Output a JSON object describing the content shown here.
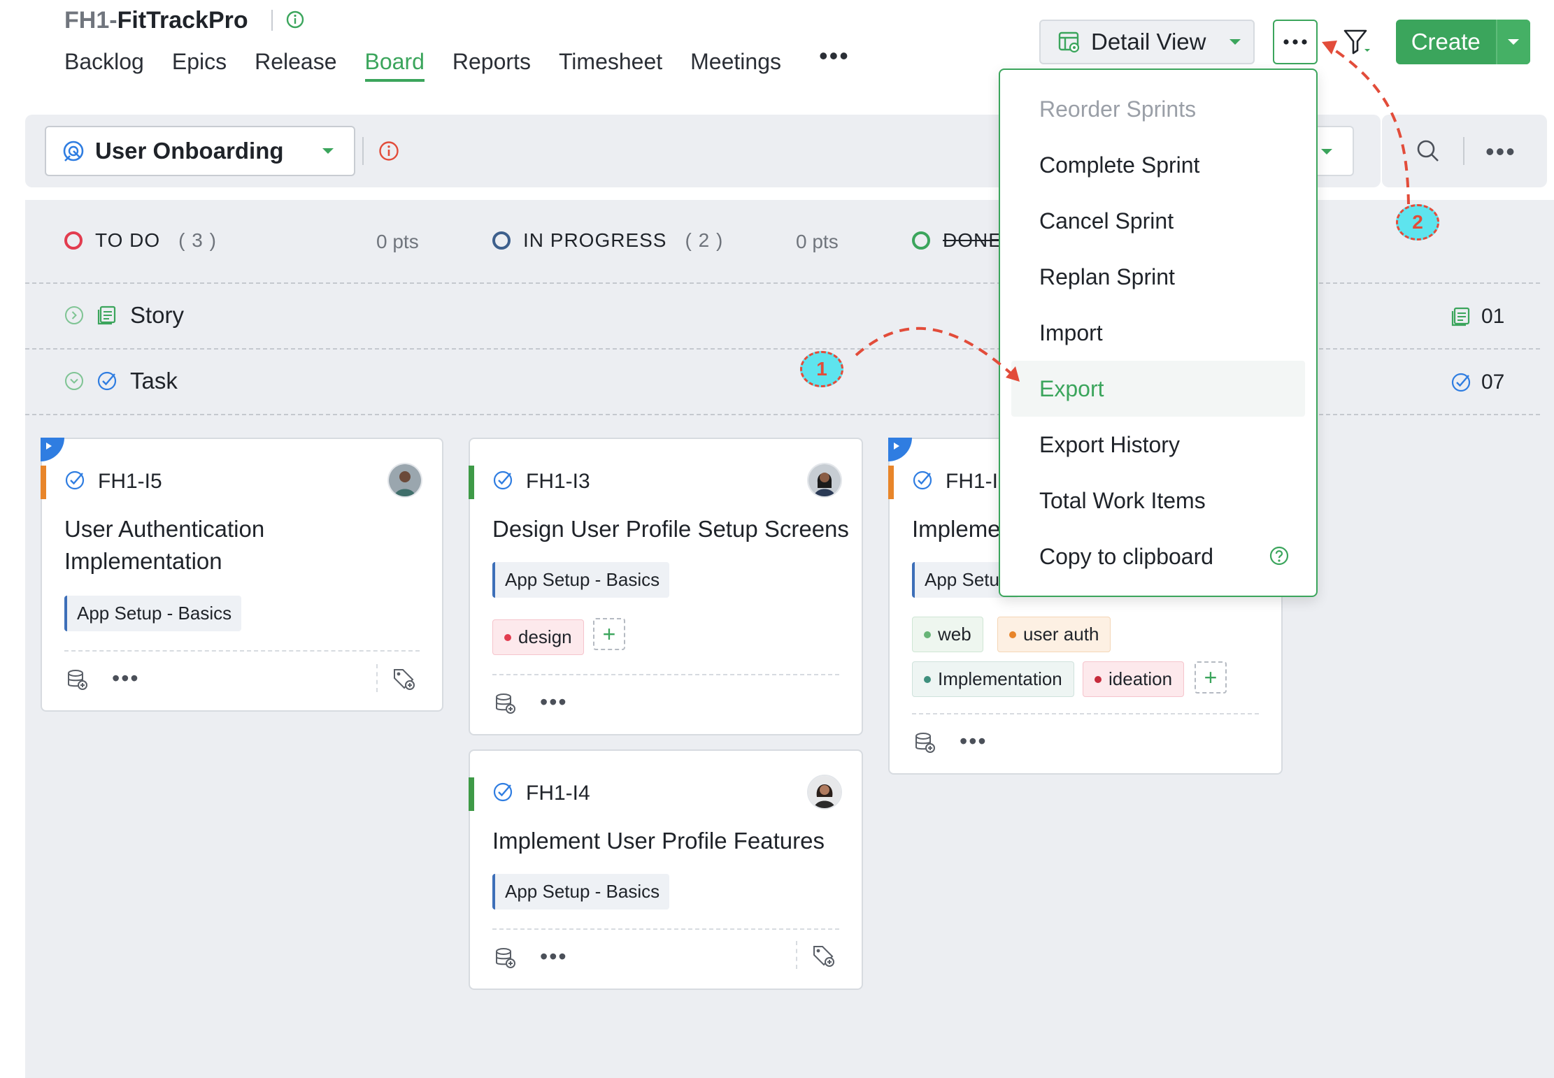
{
  "header": {
    "project_key": "FH1-",
    "project_name": "FitTrackPro",
    "nav": [
      "Backlog",
      "Epics",
      "Release",
      "Board",
      "Reports",
      "Timesheet",
      "Meetings"
    ],
    "active_nav": "Board",
    "detail_view_label": "Detail View",
    "create_label": "Create"
  },
  "sprint": {
    "name": "User Onboarding"
  },
  "columns": [
    {
      "status": "TO DO",
      "count": "( 3 )",
      "pts": "0 pts",
      "color": "#e23c4f"
    },
    {
      "status": "IN PROGRESS",
      "count": "( 2 )",
      "pts": "0 pts",
      "color": "#3d5f8c"
    },
    {
      "status": "DONE",
      "color": "#3ba55c"
    }
  ],
  "swimlanes": [
    {
      "name": "Story",
      "count": "01"
    },
    {
      "name": "Task",
      "count": "07"
    }
  ],
  "cards": {
    "c1": {
      "id": "FH1-I5",
      "title_line1": "User Authentication",
      "title_line2": "Implementation",
      "chip": "App Setup - Basics",
      "bar_color": "#e8852a"
    },
    "c2": {
      "id": "FH1-I3",
      "title": "Design User Profile Setup Screens",
      "chip": "App Setup - Basics",
      "tags": [
        "design"
      ],
      "bar_color": "#3e9a47"
    },
    "c3": {
      "id": "FH1-I2",
      "title": "Implement",
      "chip": "App Setup",
      "tags": [
        "web",
        "user auth",
        "Implementation",
        "ideation"
      ],
      "bar_color": "#e8852a"
    },
    "c4": {
      "id": "FH1-I4",
      "title": "Implement User Profile Features",
      "chip": "App Setup - Basics",
      "bar_color": "#3e9a47"
    }
  },
  "menu": {
    "items": [
      "Reorder Sprints",
      "Complete Sprint",
      "Cancel Sprint",
      "Replan Sprint",
      "Import",
      "Export",
      "Export History",
      "Total Work Items",
      "Copy to clipboard"
    ]
  },
  "annotations": {
    "step1": "1",
    "step2": "2",
    "color": "#e24c3a"
  }
}
